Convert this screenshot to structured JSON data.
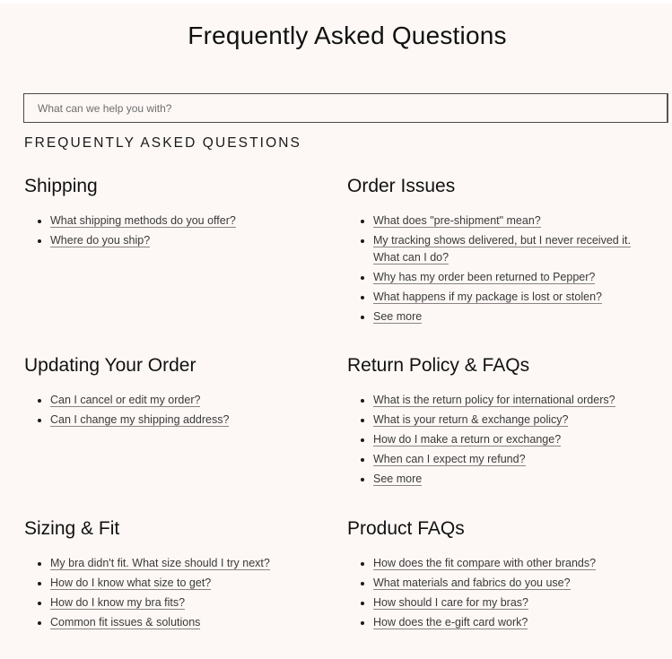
{
  "page": {
    "title": "Frequently Asked Questions",
    "section_heading": "FREQUENTLY ASKED QUESTIONS",
    "background_color": "#fdf8f5"
  },
  "search": {
    "placeholder": "What can we help you with?",
    "value": ""
  },
  "categories": [
    {
      "title": "Shipping",
      "questions": [
        "What shipping methods do you offer?",
        "Where do you ship?"
      ]
    },
    {
      "title": "Order Issues",
      "questions": [
        "What does \"pre-shipment\" mean?",
        "My tracking shows delivered, but I never received it. What can I do?",
        "Why has my order been returned to Pepper?",
        "What happens if my package is lost or stolen?",
        "See more"
      ]
    },
    {
      "title": "Updating Your Order",
      "questions": [
        "Can I cancel or edit my order?",
        "Can I change my shipping address?"
      ]
    },
    {
      "title": "Return Policy & FAQs",
      "questions": [
        "What is the return policy for international orders?",
        "What is your return & exchange policy?",
        "How do I make a return or exchange?",
        "When can I expect my refund?",
        "See more"
      ]
    },
    {
      "title": "Sizing & Fit",
      "questions": [
        "My bra didn't fit. What size should I try next?",
        "How do I know what size to get?",
        "How do I know my bra fits?",
        "Common fit issues & solutions"
      ]
    },
    {
      "title": "Product FAQs",
      "questions": [
        "How does the fit compare with other brands?",
        "What materials and fabrics do you use?",
        "How should I care for my bras?",
        "How does the e-gift card work?"
      ]
    }
  ]
}
